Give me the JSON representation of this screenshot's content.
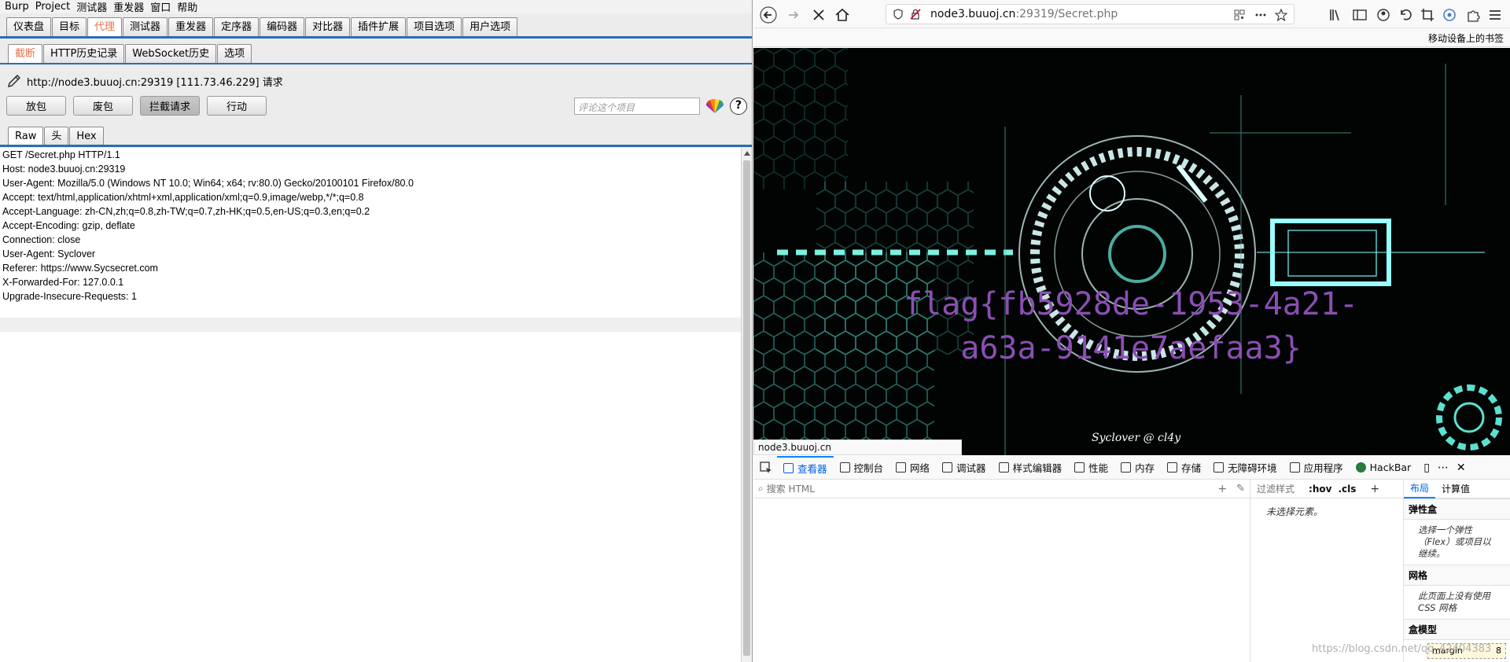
{
  "burp": {
    "menu": [
      "Burp",
      "Project",
      "测试器",
      "重发器",
      "窗口",
      "帮助"
    ],
    "main_tabs": [
      "仪表盘",
      "目标",
      "代理",
      "测试器",
      "重发器",
      "定序器",
      "编码器",
      "对比器",
      "插件扩展",
      "项目选项",
      "用户选项"
    ],
    "proxy_tabs": [
      "截断",
      "HTTP历史记录",
      "WebSocket历史",
      "选项"
    ],
    "target_label": "http://node3.buuoj.cn:29319  [111.73.46.229] 请求",
    "buttons": [
      "放包",
      "废包",
      "拦截请求",
      "行动"
    ],
    "comment_placeholder": "评论这个项目",
    "help_label": "?",
    "view_tabs": [
      "Raw",
      "头",
      "Hex"
    ],
    "request_lines": [
      "GET /Secret.php HTTP/1.1",
      "Host: node3.buuoj.cn:29319",
      "User-Agent: Mozilla/5.0 (Windows NT 10.0; Win64; x64; rv:80.0) Gecko/20100101 Firefox/80.0",
      "Accept: text/html,application/xhtml+xml,application/xml;q=0.9,image/webp,*/*;q=0.8",
      "Accept-Language: zh-CN,zh;q=0.8,zh-TW;q=0.7,zh-HK;q=0.5,en-US;q=0.3,en;q=0.2",
      "Accept-Encoding: gzip, deflate",
      "Connection: close",
      "User-Agent: Syclover",
      "Referer: https://www.Sycsecret.com",
      "X-Forwarded-For: 127.0.0.1",
      "Upgrade-Insecure-Requests: 1"
    ]
  },
  "firefox": {
    "url_domain": "node3.buuoj.cn",
    "url_rest": ":29319/Secret.php",
    "mobile_bookmarks": "移动设备上的书签",
    "flag_line1": "flag{fb5928de-1953-4a21-",
    "flag_line2": "a63a-9141e7aefaa3}",
    "signature": "Syclover @ cl4y",
    "status_text": "node3.buuoj.cn",
    "devtools_tabs": [
      "查看器",
      "控制台",
      "网络",
      "调试器",
      "样式编辑器",
      "性能",
      "内存",
      "存储",
      "无障碍环境",
      "应用程序",
      "HackBar"
    ],
    "search_html": "搜索 HTML",
    "filter_styles": "过滤样式",
    "hov": ":hov",
    "cls": ".cls",
    "no_element": "未选择元素。",
    "layout_tab": "布局",
    "computed_tab": "计算值",
    "flex_title": "弹性盒",
    "flex_text": "选择一个弹性（Flex）或项目以继续。",
    "grid_title": "网格",
    "grid_text": "此页面上没有使用 CSS 网格",
    "box_title": "盒模型",
    "margin_label": "margin",
    "margin_value": "8",
    "watermark": "https://blog.csdn.net/qq_42404383"
  }
}
